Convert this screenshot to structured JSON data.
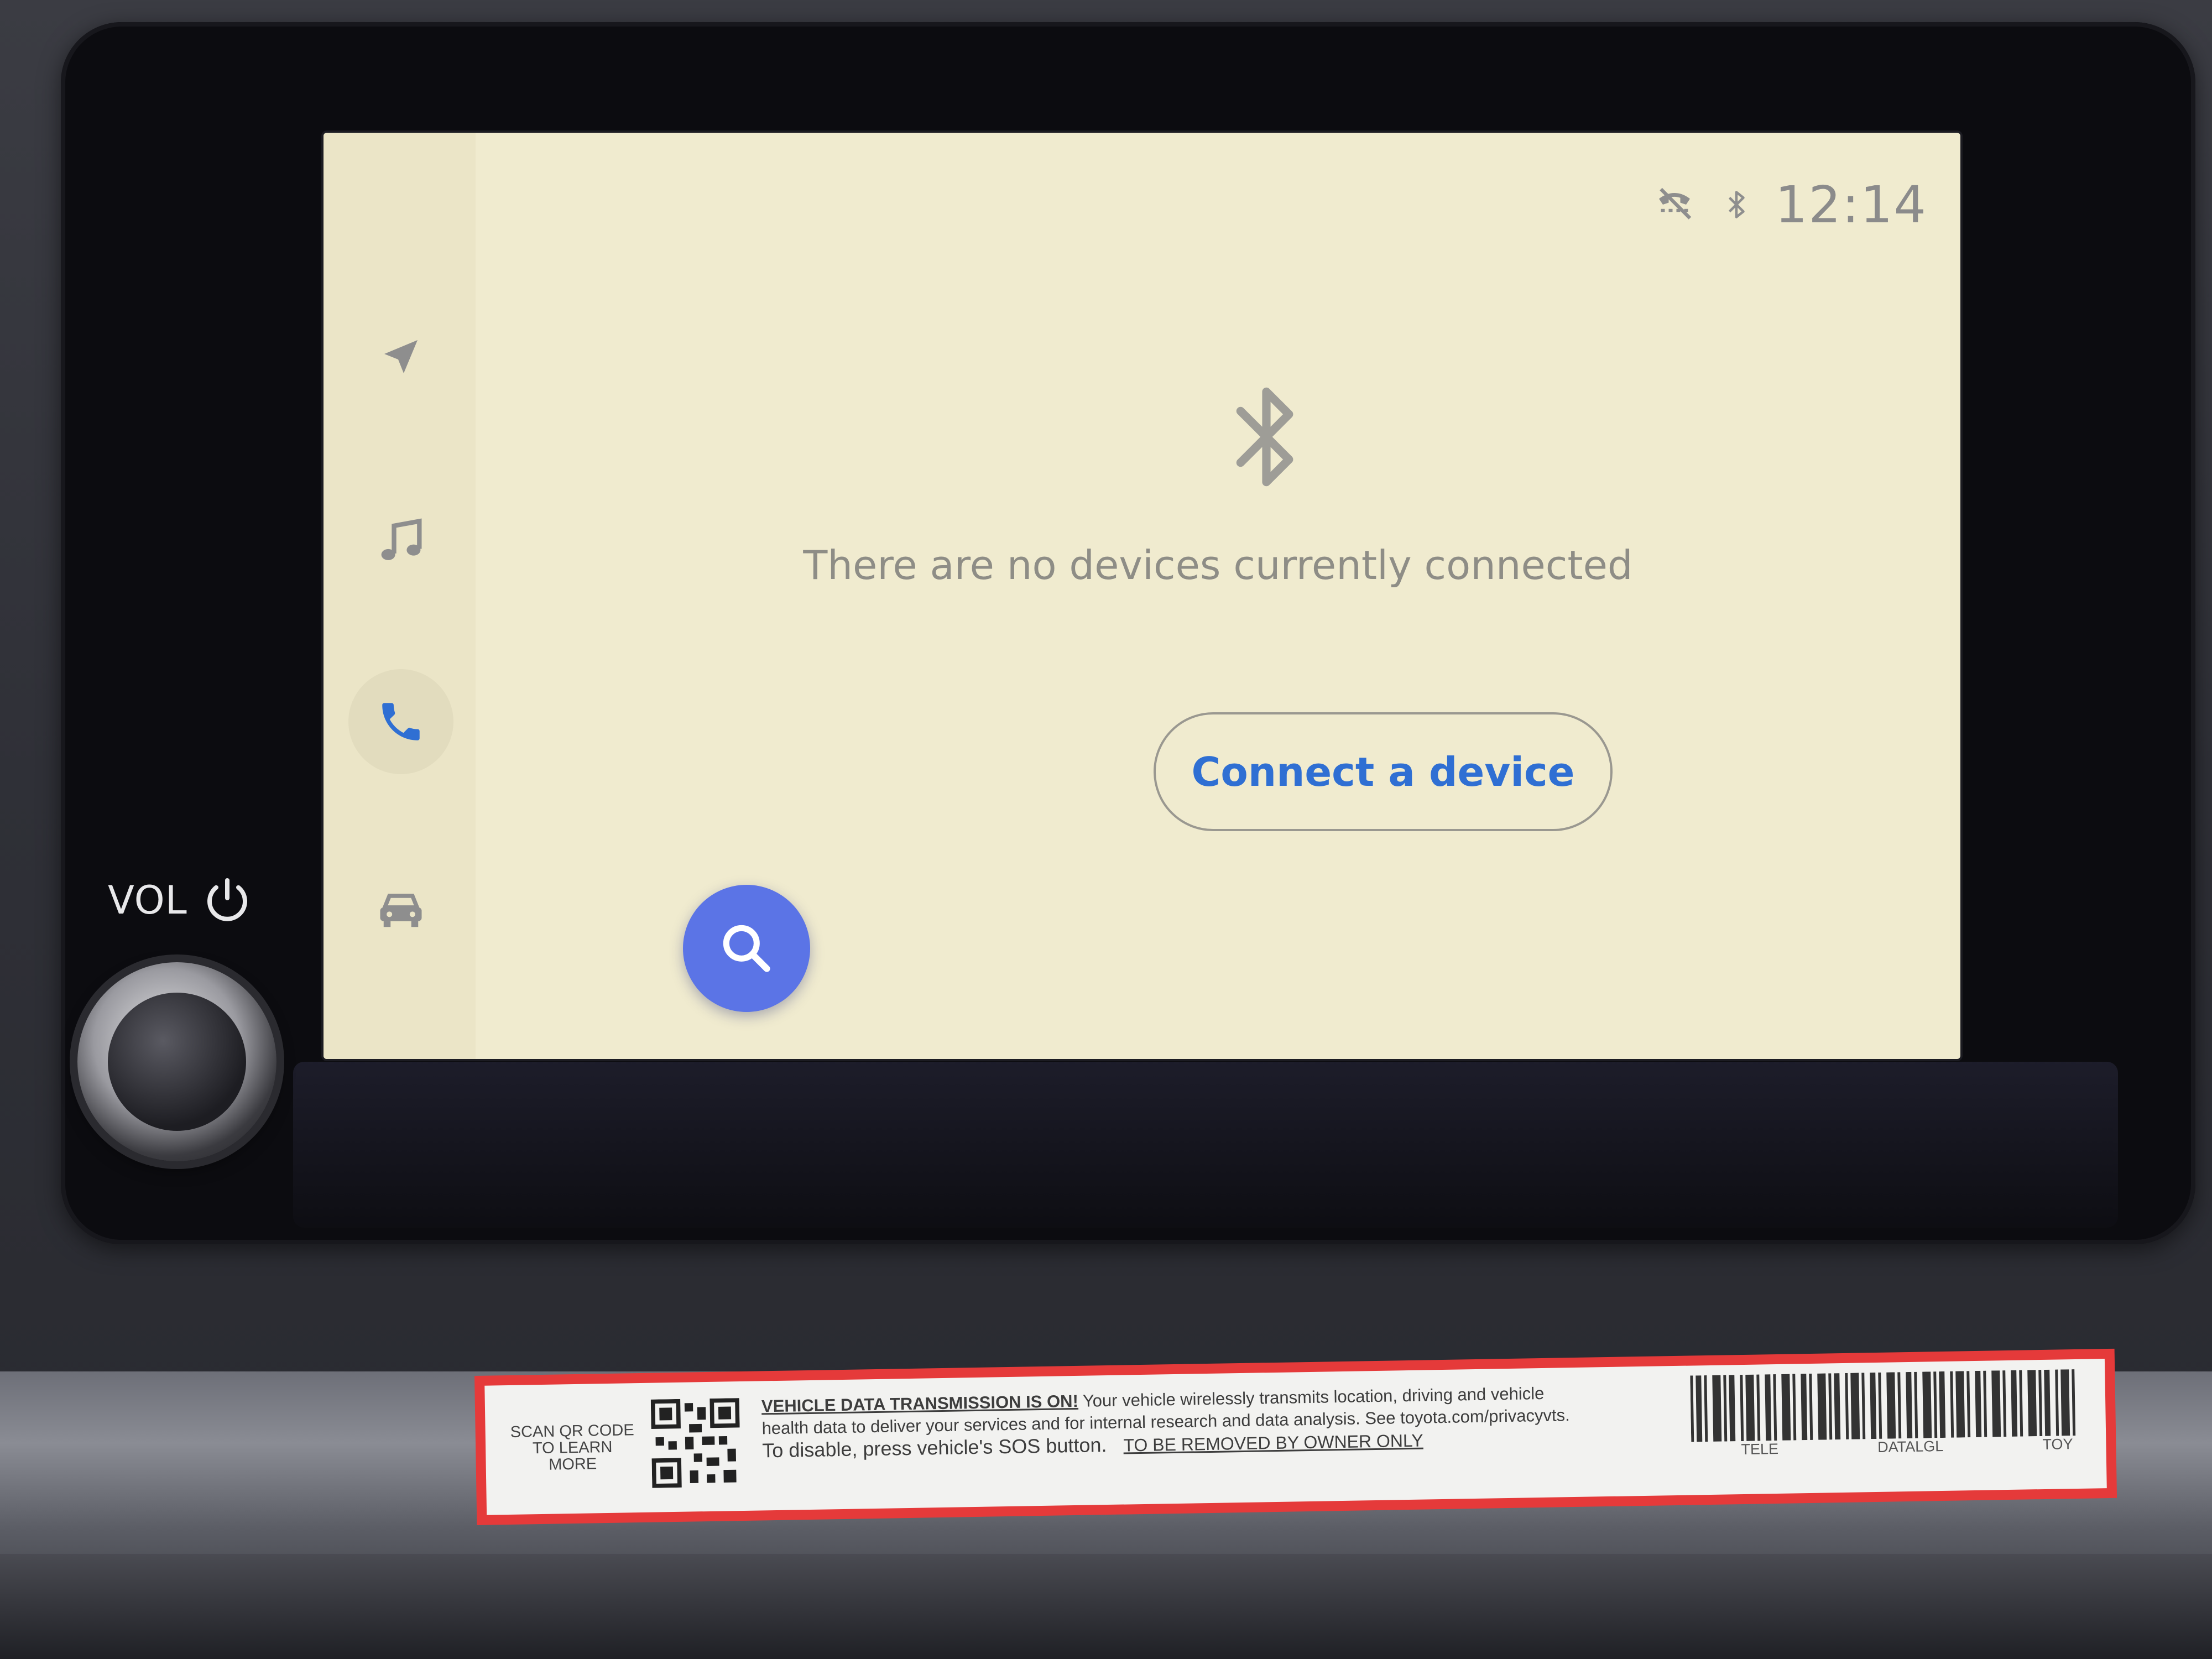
{
  "status_bar": {
    "time": "12:14",
    "icons": [
      "phone-disconnected-icon",
      "bluetooth-icon"
    ]
  },
  "nav_rail": {
    "items": [
      {
        "id": "navigation",
        "icon": "navigation-arrow-icon",
        "active": false
      },
      {
        "id": "media",
        "icon": "music-note-icon",
        "active": false
      },
      {
        "id": "phone",
        "icon": "phone-icon",
        "active": true
      },
      {
        "id": "vehicle",
        "icon": "car-icon",
        "active": false
      },
      {
        "id": "settings",
        "icon": "gear-icon",
        "active": false
      }
    ]
  },
  "main": {
    "icon": "bluetooth-icon",
    "message": "There are no devices currently connected",
    "connect_button": "Connect a device"
  },
  "search_button": {
    "icon": "search-icon"
  },
  "hardware": {
    "vol_label": "VOL"
  },
  "sticker": {
    "scan_line1": "SCAN QR CODE",
    "scan_line2": "TO LEARN MORE",
    "heading": "VEHICLE DATA TRANSMISSION IS ON!",
    "line1": "Your vehicle wirelessly transmits location, driving and vehicle",
    "line2": "health data to deliver your services and for internal research and data analysis. See toyota.com/privacyvts.",
    "line3": "To disable, press vehicle's SOS button.",
    "removal": "TO BE REMOVED BY OWNER ONLY",
    "barcode_labels": [
      "TELE",
      "DATALGL",
      "TOY"
    ]
  },
  "colors": {
    "screen_bg": "#f0ebcf",
    "accent_blue": "#2f6fd3",
    "fab_blue": "#5b74e6",
    "sticker_red": "#e53a3a"
  }
}
